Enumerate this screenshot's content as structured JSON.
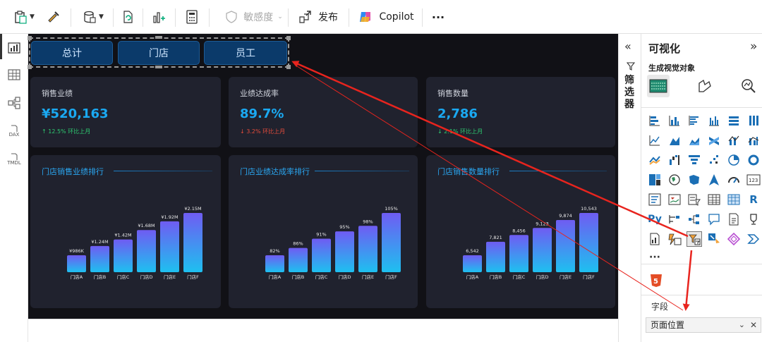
{
  "toolbar": {
    "sensitivity_label": "敏感度",
    "publish_label": "发布",
    "copilot_label": "Copilot",
    "more_label": "···"
  },
  "rail": {
    "dax_label": "DAX",
    "tmdl_label": "TMDL"
  },
  "report": {
    "nav_buttons": [
      "总计",
      "门店",
      "员工"
    ],
    "kpis": [
      {
        "title": "销售业绩",
        "value": "¥520,163",
        "change": "↑ 12.5% 环比上月",
        "direction": "up"
      },
      {
        "title": "业绩达成率",
        "value": "89.7%",
        "change": "↓ 3.2% 环比上月",
        "direction": "down"
      },
      {
        "title": "销售数量",
        "value": "2,786",
        "change": "↓ 2.1% 环比上月",
        "direction": "down"
      }
    ],
    "colors": {
      "kpi_value": "#1aa9f2",
      "up": "#2ecc71",
      "down": "#e74c3c",
      "bar_top": "#6f5cf2",
      "bar_bottom": "#1ec0f0"
    }
  },
  "chart_data": [
    {
      "type": "bar",
      "title": "门店销售业绩排行",
      "categories": [
        "门店A",
        "门店B",
        "门店C",
        "门店D",
        "门店E",
        "门店F"
      ],
      "values": [
        986000,
        1240000,
        1420000,
        1680000,
        1920000,
        2150000
      ],
      "data_labels": [
        "¥986K",
        "¥1.24M",
        "¥1.42M",
        "¥1.68M",
        "¥1.92M",
        "¥2.15M"
      ]
    },
    {
      "type": "bar",
      "title": "门店业绩达成率排行",
      "categories": [
        "门店A",
        "门店B",
        "门店C",
        "门店D",
        "门店E",
        "门店F"
      ],
      "values": [
        82,
        86,
        91,
        95,
        98,
        105
      ],
      "data_labels": [
        "82%",
        "86%",
        "91%",
        "95%",
        "98%",
        "105%"
      ]
    },
    {
      "type": "bar",
      "title": "门店销售数量排行",
      "categories": [
        "门店A",
        "门店B",
        "门店C",
        "门店D",
        "门店E",
        "门店F"
      ],
      "values": [
        6542,
        7821,
        8456,
        9123,
        9874,
        10543
      ],
      "data_labels": [
        "6,542",
        "7,821",
        "8,456",
        "9,123",
        "9,874",
        "10,543"
      ]
    }
  ],
  "filter_pane": {
    "label": "筛选器"
  },
  "viz_pane": {
    "title": "可视化",
    "subtitle": "生成视觉对象",
    "more_label": "···",
    "fields_label": "字段",
    "field_value": "页面位置",
    "py_label": "Py",
    "r_label": "R",
    "html5_label": "5",
    "card_label": "123"
  }
}
